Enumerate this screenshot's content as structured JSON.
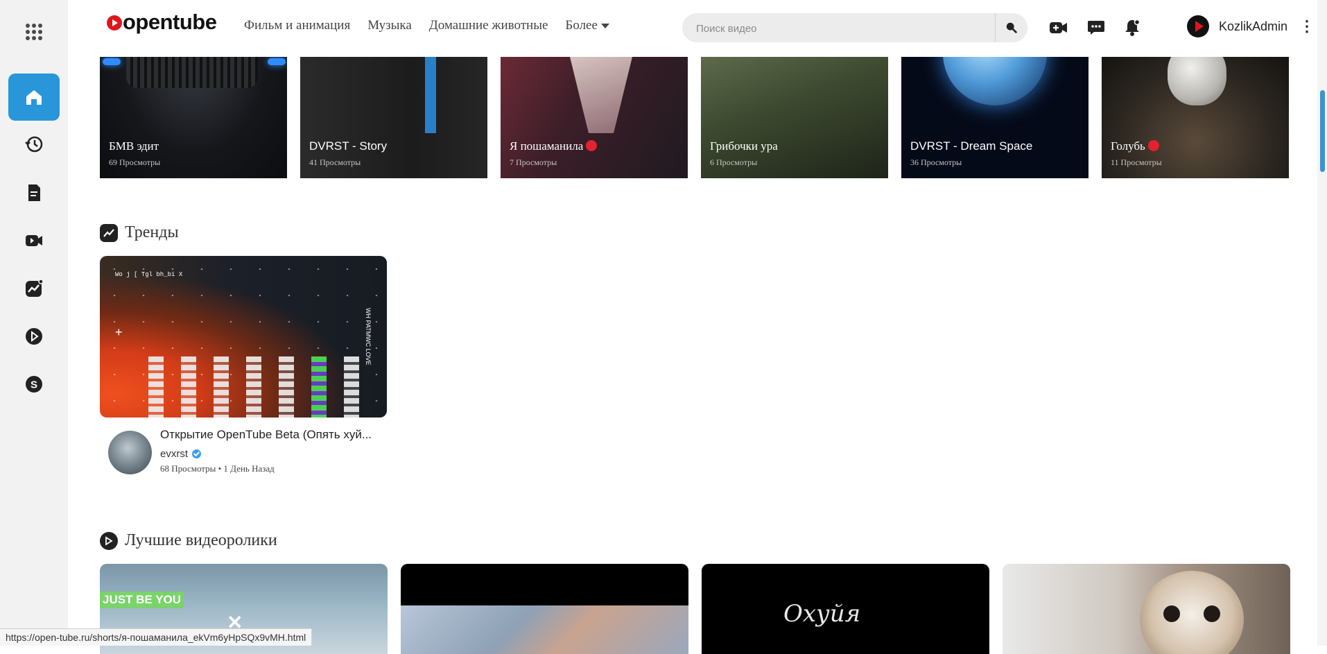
{
  "header": {
    "logo_text": "opentube",
    "nav": [
      "Фильм и анимация",
      "Музыка",
      "Домашние животные",
      "Более"
    ],
    "search_placeholder": "Поиск видео",
    "username": "KozlikAdmin"
  },
  "shorts": [
    {
      "title": "БМВ эдит",
      "views": "69 Просмотры"
    },
    {
      "title": "DVRST - Story",
      "views": "41 Просмотры"
    },
    {
      "title": "Я пошаманила",
      "views": "7 Просмотры"
    },
    {
      "title": "Грибочки ура",
      "views": "6 Просмотры"
    },
    {
      "title": "DVRST - Dream Space",
      "views": "36 Просмотры"
    },
    {
      "title": "Голубь",
      "views": "11 Просмотры"
    }
  ],
  "trends": {
    "section_title": "Тренды",
    "video": {
      "thumb_small_text": "Wo j [ Tgl bh_bi X",
      "thumb_vertical_text": "WH PATMWC LOVE",
      "title": "Открытие OpenTube Beta (Опять хуй...",
      "channel": "evxrst",
      "meta": "68 Просмотры • 1 День Назад"
    }
  },
  "best": {
    "section_title": "Лучшие видеоролики",
    "items": [
      {
        "overlay_text": "JUST BE YOU"
      },
      {
        "overlay_text": ""
      },
      {
        "overlay_text": "Охуйя"
      },
      {
        "overlay_text": ""
      }
    ]
  },
  "status_url": "https://open-tube.ru/shorts/я-пошаманила_ekVm6yHpSQx9vMH.html"
}
